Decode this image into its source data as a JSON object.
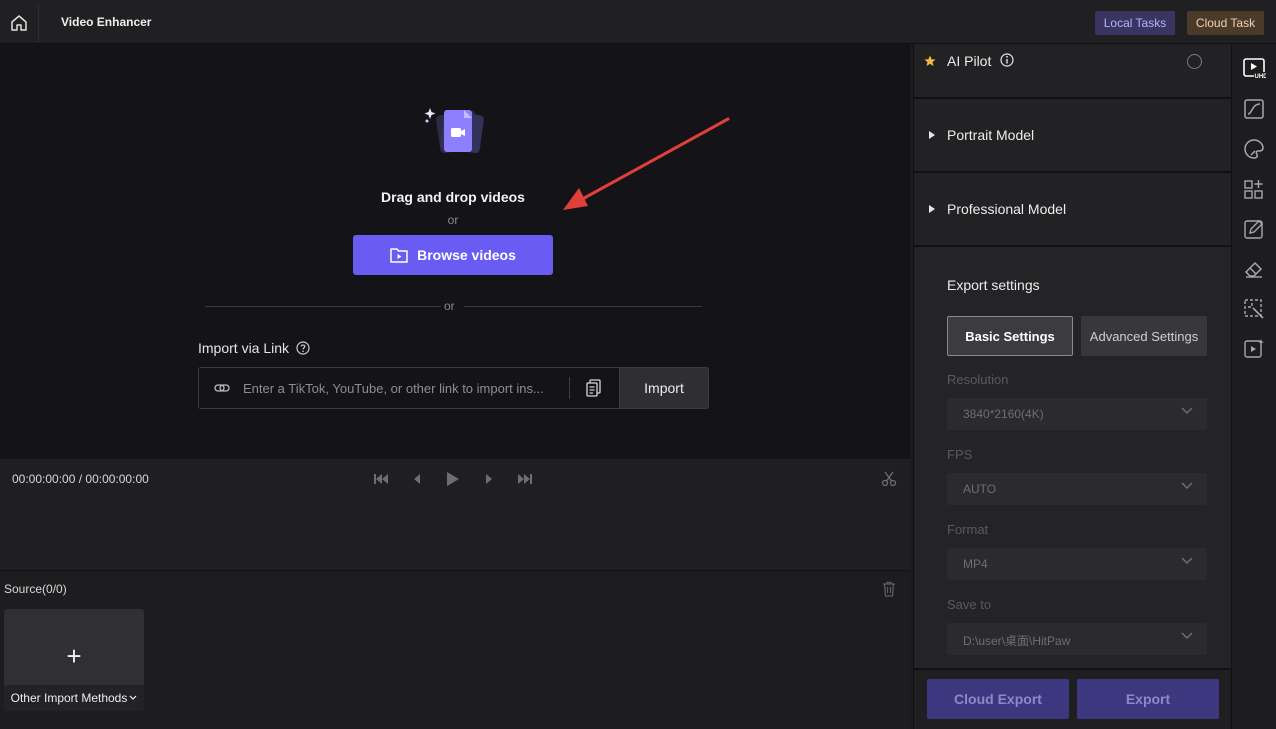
{
  "header": {
    "title": "Video Enhancer",
    "local_tasks": "Local Tasks",
    "cloud_task": "Cloud Task"
  },
  "dropzone": {
    "drag_text": "Drag and drop videos",
    "or_text": "or",
    "browse_label": "Browse videos",
    "or_divider": "or",
    "import_label": "Import via Link",
    "link_placeholder": "Enter a TikTok, YouTube, or other link to import ins...",
    "import_button": "Import"
  },
  "player": {
    "timecode": "00:00:00:00 / 00:00:00:00"
  },
  "source": {
    "label": "Source(0/0)",
    "plus": "+",
    "other_methods": "Other Import Methods"
  },
  "panel": {
    "ai_pilot": "AI Pilot",
    "portrait_model": "Portrait Model",
    "professional_model": "Professional Model",
    "export_title": "Export settings",
    "basic_tab": "Basic Settings",
    "advanced_tab": "Advanced Settings",
    "resolution_label": "Resolution",
    "resolution_value": "3840*2160(4K)",
    "fps_label": "FPS",
    "fps_value": "AUTO",
    "format_label": "Format",
    "format_value": "MP4",
    "save_to_label": "Save to",
    "save_to_value": "D:\\user\\桌面\\HitPaw",
    "cloud_export": "Cloud Export",
    "export": "Export"
  },
  "rail_icons": [
    "uhd-video-icon",
    "curve-icon",
    "colorize-icon",
    "grid-plus-icon",
    "edit-image-icon",
    "eraser-icon",
    "magic-select-icon",
    "video-sparkle-icon"
  ],
  "colors": {
    "accent": "#6a5cf3",
    "local_tasks_bg": "#3a3560",
    "cloud_task_bg": "#4a3a2a",
    "arrow": "#e0403a",
    "star": "#f5b740"
  }
}
